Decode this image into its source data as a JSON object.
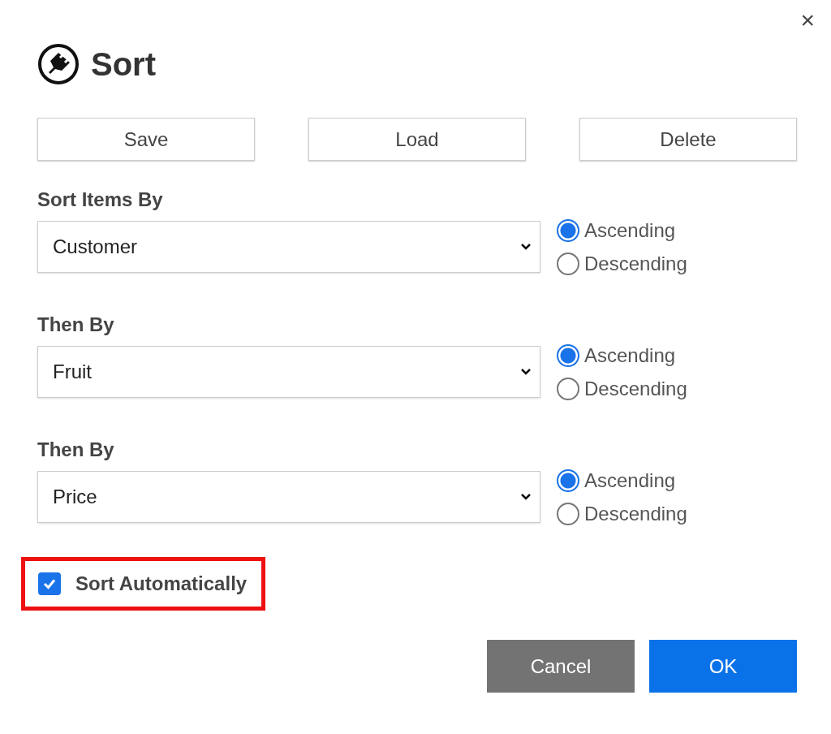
{
  "dialog": {
    "title": "Sort",
    "close": "×"
  },
  "toolbar": [
    {
      "label": "Save"
    },
    {
      "label": "Load"
    },
    {
      "label": "Delete"
    }
  ],
  "levels": [
    {
      "label": "Sort Items By",
      "value": "Customer",
      "options": [
        {
          "label": "Ascending",
          "selected": true
        },
        {
          "label": "Descending",
          "selected": false
        }
      ]
    },
    {
      "label": "Then By",
      "value": "Fruit",
      "options": [
        {
          "label": "Ascending",
          "selected": true
        },
        {
          "label": "Descending",
          "selected": false
        }
      ]
    },
    {
      "label": "Then By",
      "value": "Price",
      "options": [
        {
          "label": "Ascending",
          "selected": true
        },
        {
          "label": "Descending",
          "selected": false
        }
      ]
    }
  ],
  "auto_sort": {
    "label": "Sort Automatically",
    "checked": true,
    "highlighted": true
  },
  "footer": [
    {
      "label": "Cancel",
      "kind": "secondary"
    },
    {
      "label": "OK",
      "kind": "primary"
    }
  ]
}
